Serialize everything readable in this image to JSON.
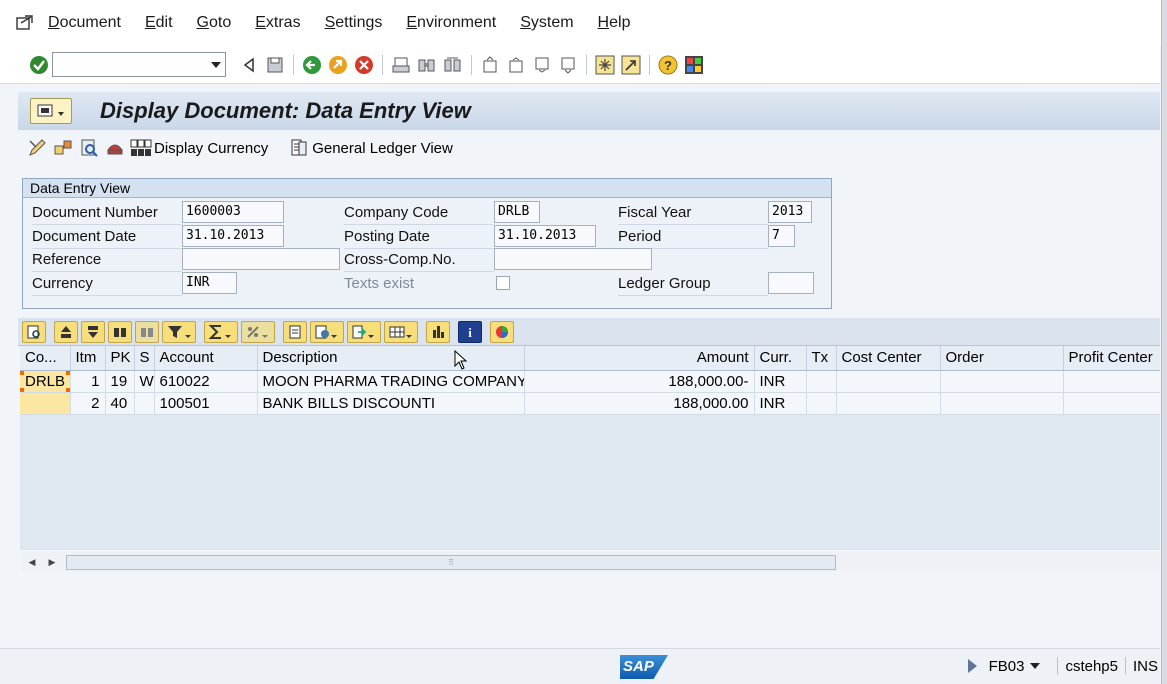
{
  "menu": [
    "Document",
    "Edit",
    "Goto",
    "Extras",
    "Settings",
    "Environment",
    "System",
    "Help"
  ],
  "toolbar": {
    "command_value": ""
  },
  "title": "Display Document: Data Entry View",
  "app_toolbar": {
    "display_currency": "Display Currency",
    "general_ledger_view": "General Ledger View"
  },
  "group": {
    "title": "Data Entry View",
    "document_number_label": "Document Number",
    "document_number": "1600003",
    "company_code_label": "Company Code",
    "company_code": "DRLB",
    "fiscal_year_label": "Fiscal Year",
    "fiscal_year": "2013",
    "document_date_label": "Document Date",
    "document_date": "31.10.2013",
    "posting_date_label": "Posting Date",
    "posting_date": "31.10.2013",
    "period_label": "Period",
    "period": "7",
    "reference_label": "Reference",
    "reference": "",
    "cross_comp_label": "Cross-Comp.No.",
    "cross_comp": "",
    "currency_label": "Currency",
    "currency": "INR",
    "texts_exist_label": "Texts exist",
    "ledger_group_label": "Ledger Group",
    "ledger_group": ""
  },
  "table": {
    "headers": [
      "Co...",
      "Itm",
      "PK",
      "S",
      "Account",
      "Description",
      "Amount",
      "Curr.",
      "Tx",
      "Cost Center",
      "Order",
      "Profit Center"
    ],
    "rows": [
      [
        "DRLB",
        "1",
        "19",
        "W",
        "610022",
        "MOON PHARMA TRADING COMPANY",
        "188,000.00-",
        "INR",
        "",
        "",
        "",
        ""
      ],
      [
        "",
        "2",
        "40",
        "",
        "100501",
        "BANK BILLS DISCOUNTI",
        "188,000.00",
        "INR",
        "",
        "",
        "",
        ""
      ]
    ]
  },
  "status": {
    "transaction": "FB03",
    "server": "cstehp5",
    "mode": "INS",
    "logo": "SAP"
  },
  "colors": {
    "background": "#f1f5fa",
    "title_band": "#c9d7e8",
    "alv_icon": "#f6df7a",
    "sap_blue": "#0f5cae"
  }
}
